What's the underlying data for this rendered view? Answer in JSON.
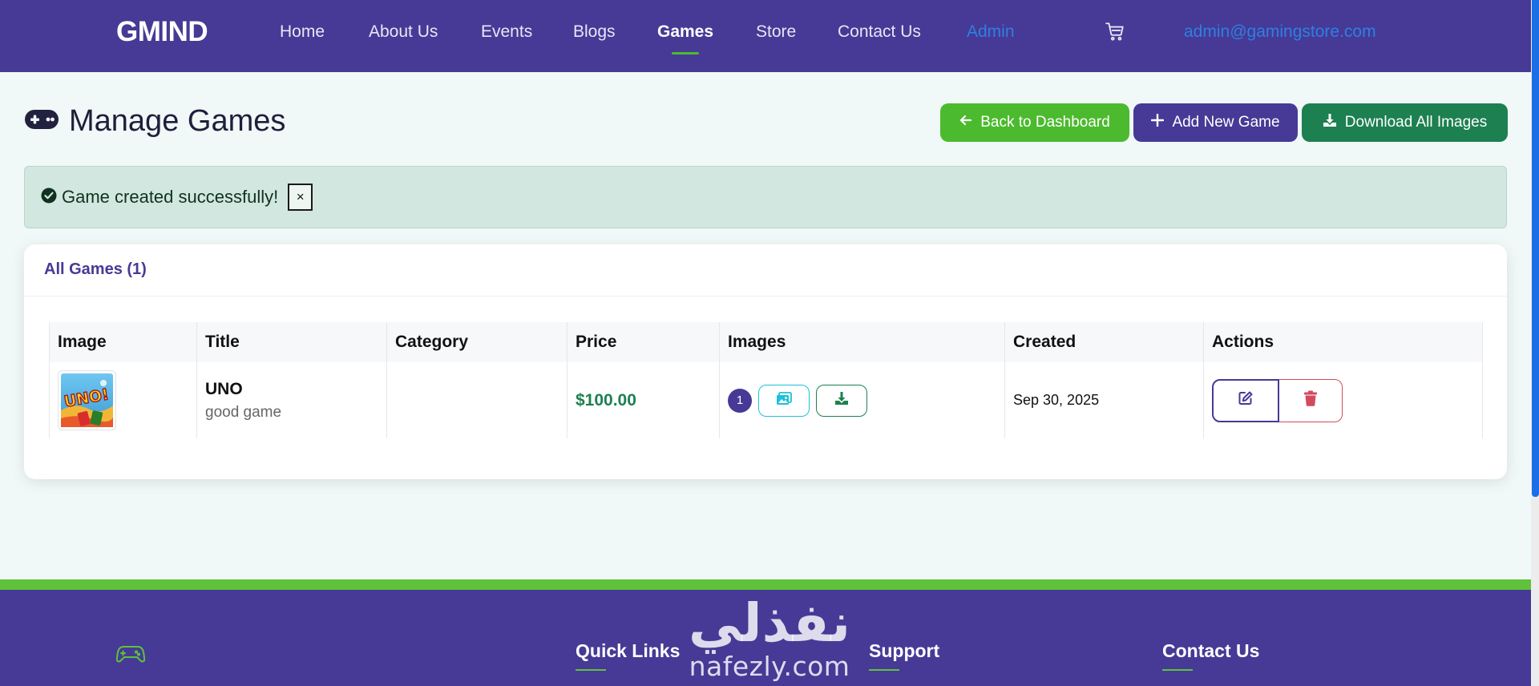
{
  "nav": {
    "brand": "GMIND",
    "links": [
      "Home",
      "About Us",
      "Events",
      "Blogs",
      "Games",
      "Store",
      "Contact Us",
      "Admin"
    ],
    "active": "Games",
    "email": "admin@gamingstore.com"
  },
  "header": {
    "title": "Manage Games",
    "buttons": {
      "back": "Back to Dashboard",
      "add": "Add New Game",
      "download": "Download All Images"
    }
  },
  "alert": {
    "message": "Game created successfully!",
    "close": "×"
  },
  "games": {
    "heading": "All Games (1)",
    "columns": [
      "Image",
      "Title",
      "Category",
      "Price",
      "Images",
      "Created",
      "Actions"
    ],
    "rows": [
      {
        "title": "UNO",
        "description": "good game",
        "category": "",
        "price": "$100.00",
        "image_count": "1",
        "created": "Sep 30, 2025",
        "thumbnail_text": "UNO!"
      }
    ]
  },
  "footer": {
    "headings": [
      "Quick Links",
      "Support",
      "Contact Us"
    ]
  },
  "watermark": {
    "arabic": "نفذلي",
    "latin": "nafezly.com"
  },
  "colors": {
    "nav_bg": "#463a96",
    "accent_green": "#4cba2e",
    "dark_green": "#1d8050",
    "admin_blue": "#2f7fe0",
    "danger": "#d34a5e"
  }
}
